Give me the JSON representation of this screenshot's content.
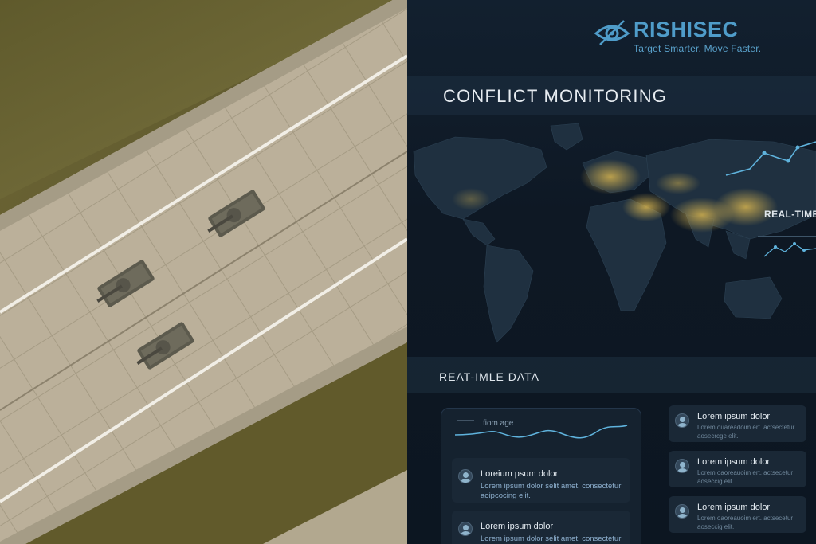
{
  "brand": {
    "name": "RISHISEC",
    "tagline": "Target Smarter. Move Faster.",
    "accent": "#4f9cc9"
  },
  "dashboard": {
    "title": "CONFLICT MONITORING",
    "side_label": "REAL-TIME",
    "data_section_title": "REAT-IMLE DATA",
    "sparkline_label": "fiom age"
  },
  "feed_left": [
    {
      "title": "Loreium psum dolor",
      "body_line1": "Lorem ipsum dolor selit amet, consectetur",
      "body_line2": "aoipcocing elit."
    },
    {
      "title": "Lorem ipsum dolor",
      "body_line1": "Lorem ipsum dolor selit amet, consectetur",
      "body_line2": ""
    }
  ],
  "feed_right": [
    {
      "title": "Lorem ipsum dolor",
      "body_line1": "Lorem ouareadoim ert. actsectetur",
      "body_line2": "aosecrcge elit."
    },
    {
      "title": "Lorem ipsum dolor",
      "body_line1": "Lorem oaoreauoim ert. actsecetur",
      "body_line2": "aoseccig elit."
    },
    {
      "title": "Lorem ipsum dolor",
      "body_line1": "Lorem oaoreauoim ert. actsecetur",
      "body_line2": "aoseccig elit."
    }
  ],
  "icons": [
    "eye-logo-icon",
    "world-map",
    "sparkline",
    "user-avatar-icon"
  ],
  "colors": {
    "background": "#0f1a26",
    "heat": "#c8a84a",
    "line": "#5fb3dd"
  }
}
